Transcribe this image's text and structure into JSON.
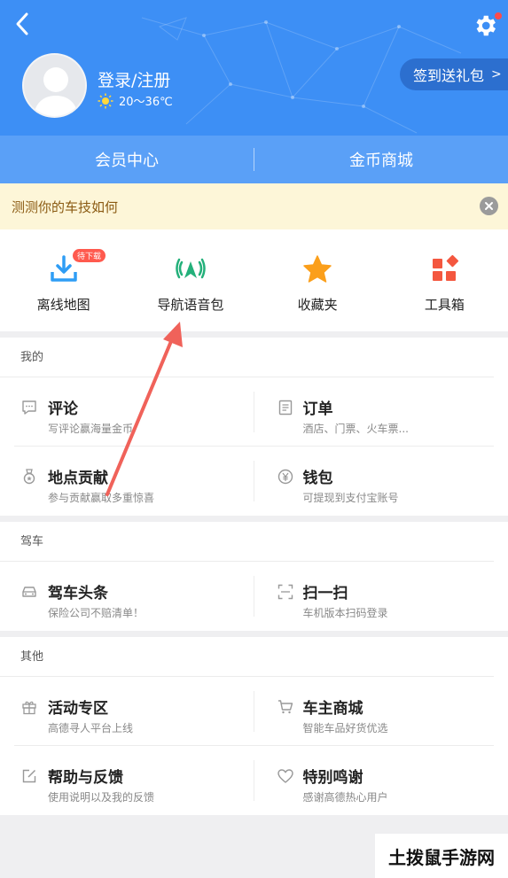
{
  "header": {
    "login_label": "登录/注册",
    "weather_text": "20～36℃",
    "sign_in_label": "签到送礼包",
    "sign_in_arrow": ">"
  },
  "member_bar": {
    "items": [
      {
        "label": "会员中心"
      },
      {
        "label": "金币商城"
      }
    ]
  },
  "notice": {
    "text": "测测你的车技如何"
  },
  "quick_actions": [
    {
      "label": "离线地图",
      "icon": "download-icon",
      "badge": "待下载"
    },
    {
      "label": "导航语音包",
      "icon": "voice-signal-icon"
    },
    {
      "label": "收藏夹",
      "icon": "star-icon"
    },
    {
      "label": "工具箱",
      "icon": "toolbox-icon"
    }
  ],
  "sections": {
    "mine": {
      "title": "我的",
      "items": [
        {
          "title": "评论",
          "sub": "写评论赢海量金币",
          "icon": "comment-icon"
        },
        {
          "title": "订单",
          "sub": "酒店、门票、火车票...",
          "icon": "order-icon"
        },
        {
          "title": "地点贡献",
          "sub": "参与贡献赢取多重惊喜",
          "icon": "medal-icon"
        },
        {
          "title": "钱包",
          "sub": "可提现到支付宝账号",
          "icon": "wallet-icon"
        }
      ]
    },
    "drive": {
      "title": "驾车",
      "items": [
        {
          "title": "驾车头条",
          "sub": "保险公司不赔清单！",
          "icon": "car-icon"
        },
        {
          "title": "扫一扫",
          "sub": "车机版本扫码登录",
          "icon": "scan-icon"
        }
      ]
    },
    "other": {
      "title": "其他",
      "items": [
        {
          "title": "活动专区",
          "sub": "高德寻人平台上线",
          "icon": "gift-icon"
        },
        {
          "title": "车主商城",
          "sub": "智能车品好货优选",
          "icon": "cart-icon"
        },
        {
          "title": "帮助与反馈",
          "sub": "使用说明以及我的反馈",
          "icon": "edit-icon"
        },
        {
          "title": "特别鸣谢",
          "sub": "感谢高德热心用户",
          "icon": "heart-icon"
        }
      ]
    }
  },
  "watermark": "土拨鼠手游网",
  "colors": {
    "header_blue": "#3d8ff5",
    "member_bar_blue": "#5aa0f7",
    "annotation_red": "#f0625a",
    "badge_red": "#ff5a4e"
  }
}
